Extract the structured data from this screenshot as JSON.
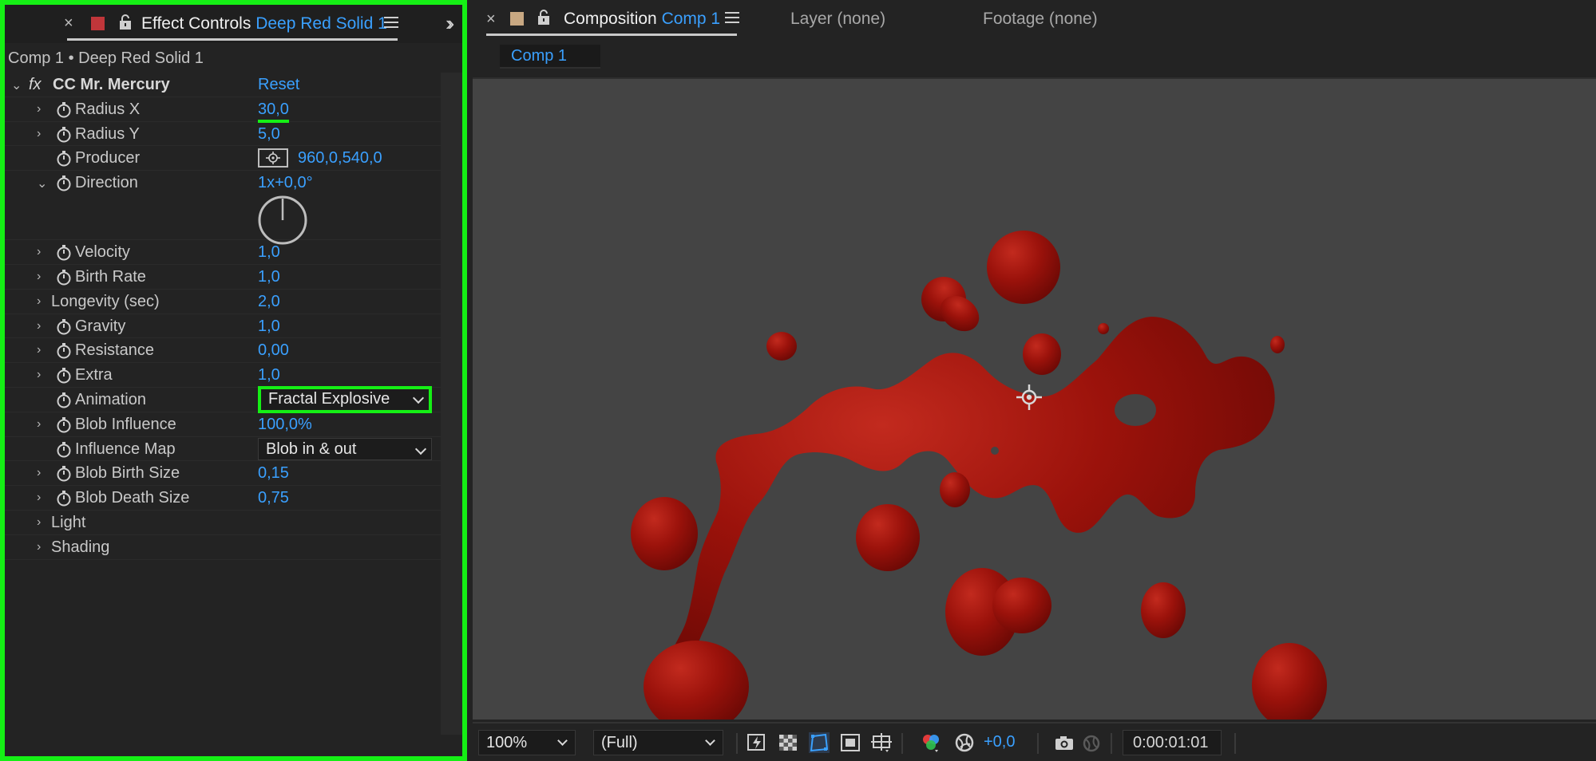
{
  "effect_panel": {
    "title": "Effect Controls",
    "layer_name": "Deep Red Solid 1",
    "breadcrumb": "Comp 1 • Deep Red Solid 1",
    "effect_name": "CC Mr. Mercury",
    "fx_label": "fx",
    "reset_label": "Reset",
    "properties": [
      {
        "label": "Radius X",
        "value": "30,0"
      },
      {
        "label": "Radius Y",
        "value": "5,0"
      },
      {
        "label": "Producer",
        "value": "960,0,540,0"
      },
      {
        "label": "Direction",
        "value": "1x+0,0°"
      },
      {
        "label": "Velocity",
        "value": "1,0"
      },
      {
        "label": "Birth Rate",
        "value": "1,0"
      },
      {
        "label": "Longevity (sec)",
        "value": "2,0"
      },
      {
        "label": "Gravity",
        "value": "1,0"
      },
      {
        "label": "Resistance",
        "value": "0,00"
      },
      {
        "label": "Extra",
        "value": "1,0"
      },
      {
        "label": "Animation",
        "value": "Fractal Explosive"
      },
      {
        "label": "Blob Influence",
        "value": "100,0%"
      },
      {
        "label": "Influence Map",
        "value": "Blob in & out"
      },
      {
        "label": "Blob Birth Size",
        "value": "0,15"
      },
      {
        "label": "Blob Death Size",
        "value": "0,75"
      },
      {
        "label": "Light",
        "value": ""
      },
      {
        "label": "Shading",
        "value": ""
      }
    ]
  },
  "comp_panel": {
    "title": "Composition",
    "comp_name": "Comp 1",
    "layer_tab": "Layer (none)",
    "footage_tab": "Footage (none)",
    "subtab": "Comp 1"
  },
  "toolbar": {
    "zoom": "100%",
    "resolution": "(Full)",
    "exposure": "+0,0",
    "timecode": "0:00:01:01"
  },
  "colors": {
    "highlight": "#15ef15",
    "accent": "#3aa0ff",
    "blob": "#9b120b",
    "layer_swatch": "#c0363a",
    "comp_swatch": "#c8a882"
  }
}
